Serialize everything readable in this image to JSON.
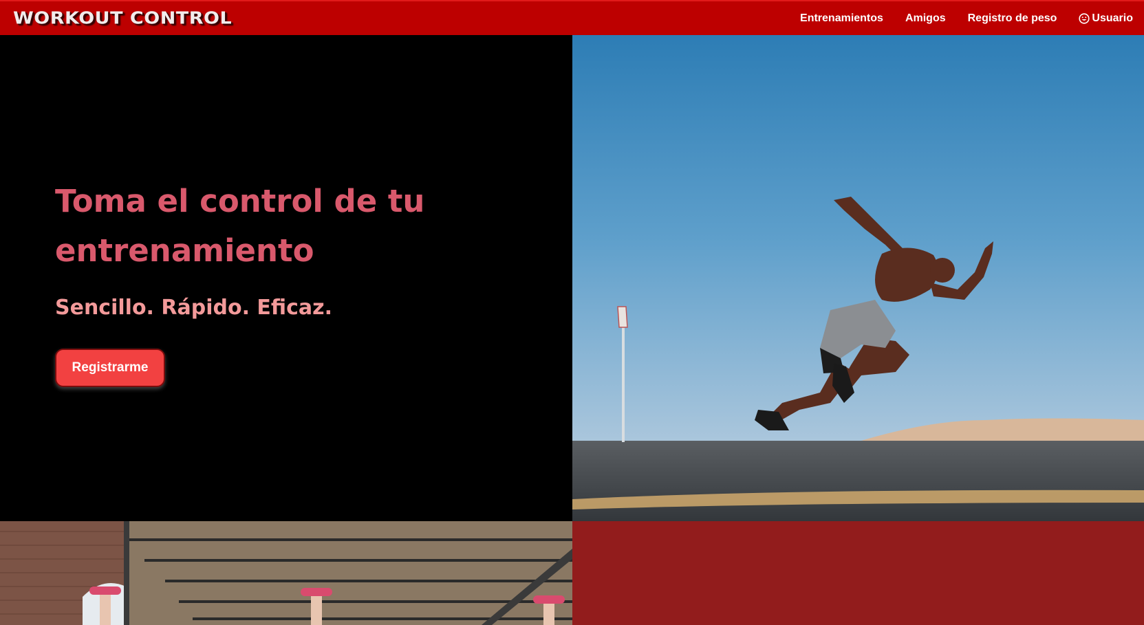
{
  "navbar": {
    "brand": "WORKOUT CONTROL",
    "links": [
      {
        "label": "Entrenamientos"
      },
      {
        "label": "Amigos"
      },
      {
        "label": "Registro de peso"
      }
    ],
    "user": {
      "label": "Usuario",
      "icon": "smiley-icon"
    }
  },
  "hero": {
    "title": "Toma el control de tu entrenamiento",
    "subtitle": "Sencillo. Rápido. Eficaz.",
    "cta_label": "Registrarme"
  },
  "colors": {
    "navbar_bg": "#bd0000",
    "title": "#d9596c",
    "subtitle": "#f39a9a",
    "button_bg": "#f24141",
    "bottom_panel": "#921c1c"
  }
}
